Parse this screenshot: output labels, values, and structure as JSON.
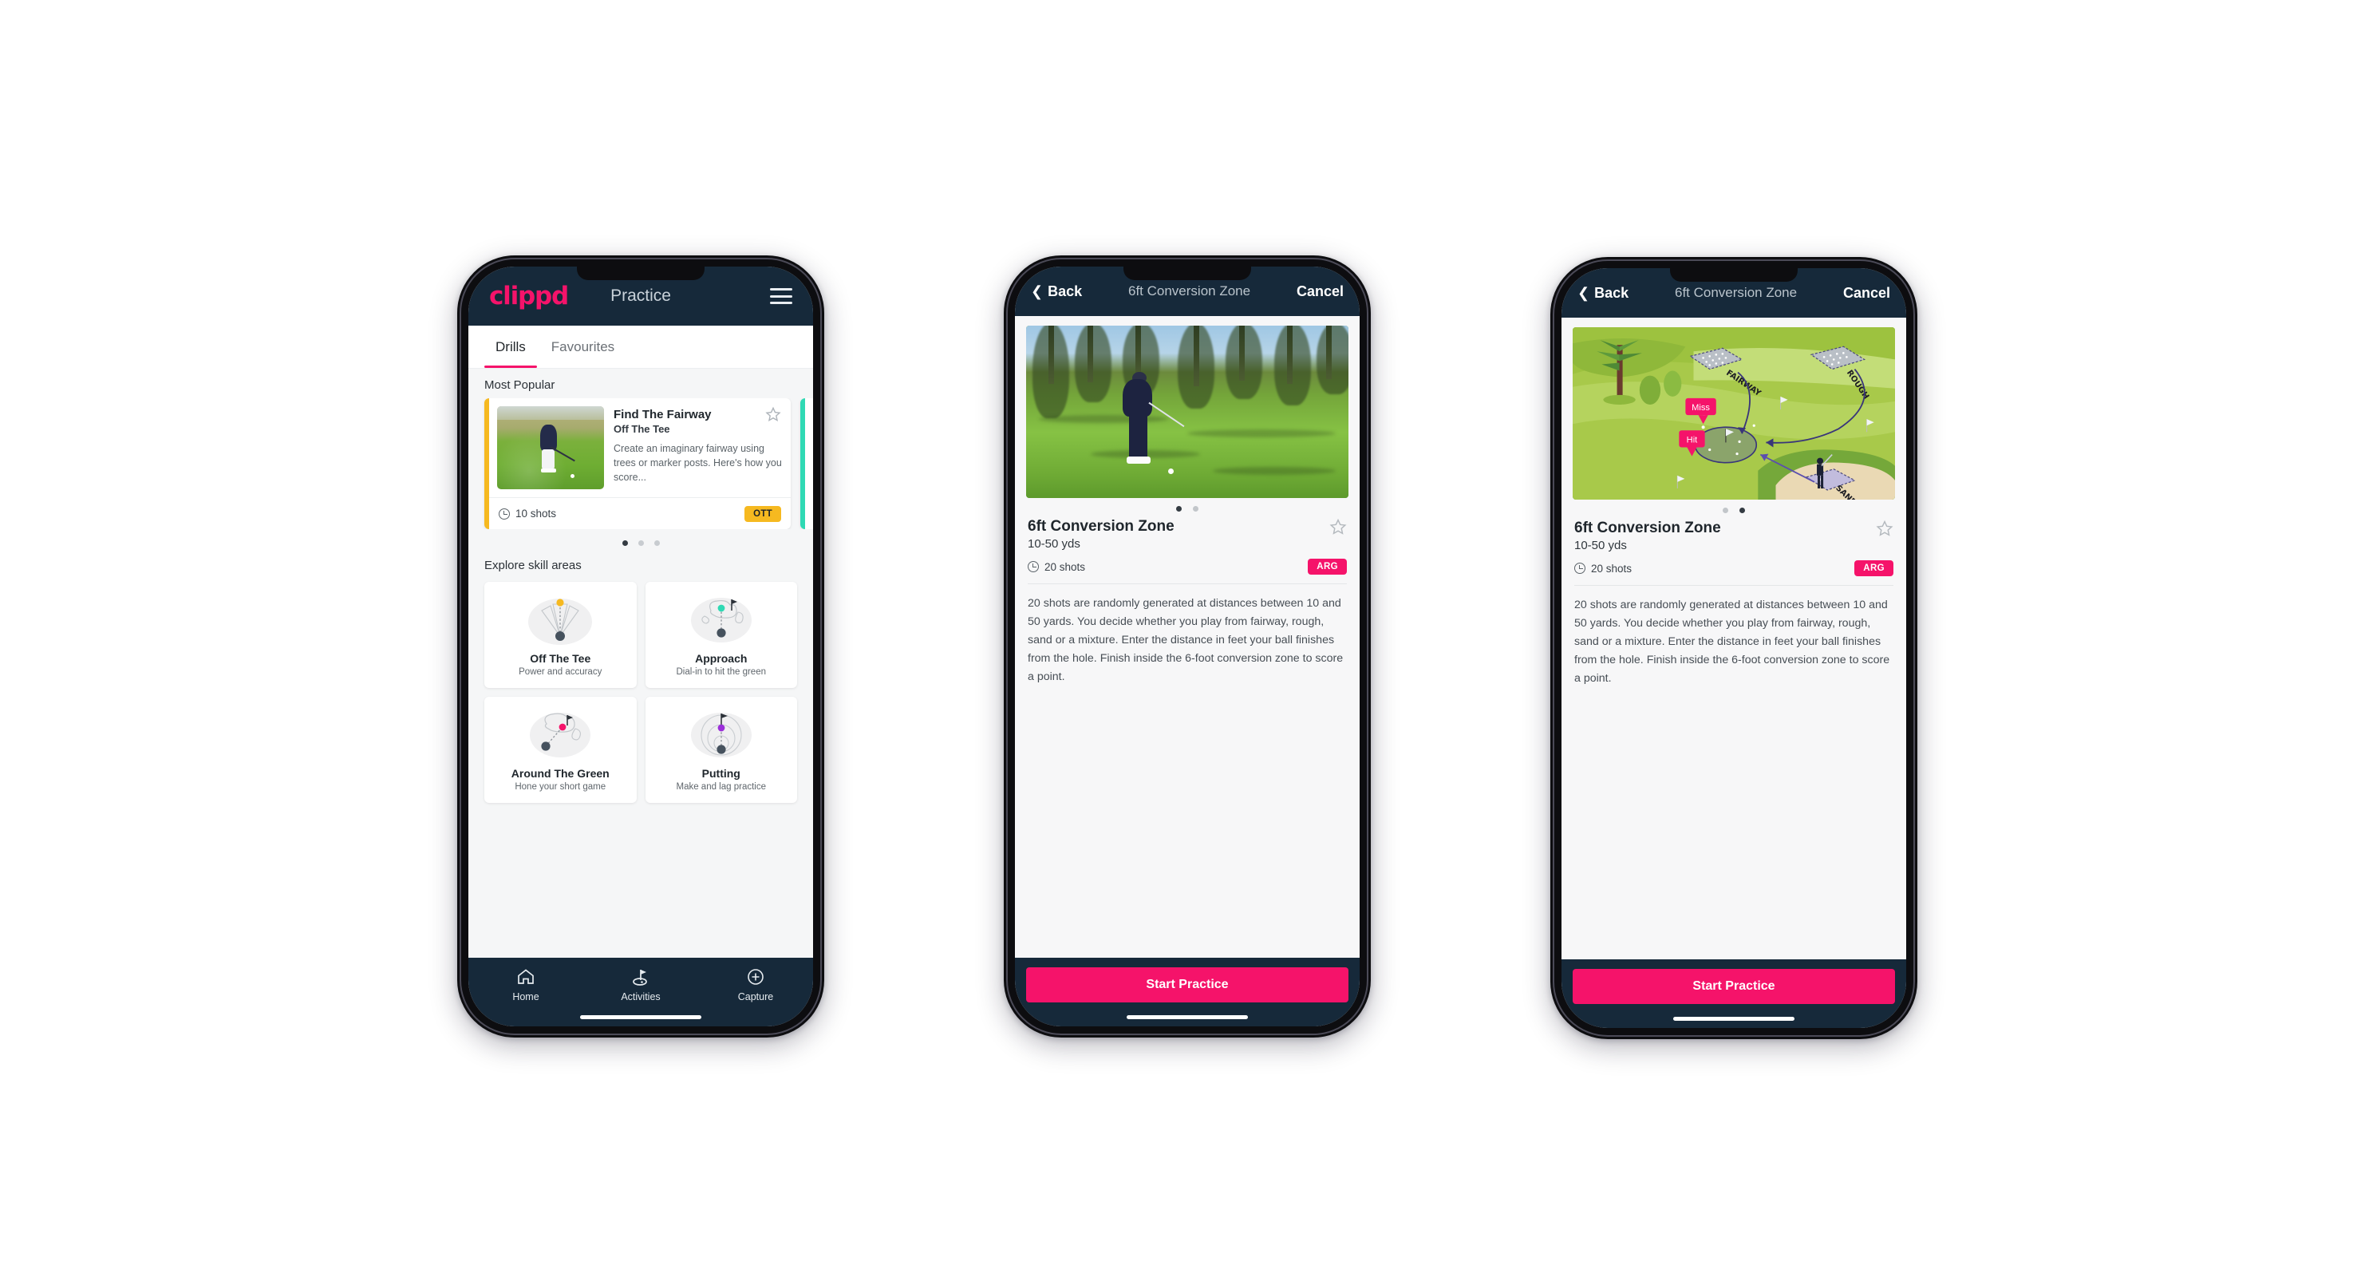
{
  "brand": {
    "accent_pink": "#f5136a",
    "navy": "#16293a",
    "amber": "#f6b920",
    "teal": "#2fd9b4"
  },
  "phone1": {
    "topbar": {
      "logo": "clippd",
      "title": "Practice",
      "menu_icon": "hamburger-icon"
    },
    "tabs": [
      {
        "label": "Drills",
        "active": true
      },
      {
        "label": "Favourites",
        "active": false
      }
    ],
    "most_popular": {
      "section_label": "Most Popular",
      "card": {
        "title": "Find The Fairway",
        "subtitle": "Off The Tee",
        "description": "Create an imaginary fairway using trees or marker posts. Here's how you score...",
        "shots": "10 shots",
        "badge": "OTT",
        "badge_color": "#f6b920",
        "favourite_icon": "star-outline-icon"
      },
      "dots": {
        "count": 3,
        "active_index": 0
      }
    },
    "skills": {
      "section_label": "Explore skill areas",
      "items": [
        {
          "name": "Off The Tee",
          "desc": "Power and accuracy",
          "icon": "tee-fan-icon",
          "accent": "#f6b920"
        },
        {
          "name": "Approach",
          "desc": "Dial-in to hit the green",
          "icon": "green-approach-icon",
          "accent": "#2fd9b4"
        },
        {
          "name": "Around The Green",
          "desc": "Hone your short game",
          "icon": "chip-green-icon",
          "accent": "#f5136a"
        },
        {
          "name": "Putting",
          "desc": "Make and lag practice",
          "icon": "putting-rings-icon",
          "accent": "#9b30d9"
        }
      ]
    },
    "tabbar": [
      {
        "label": "Home",
        "icon": "home-icon",
        "active": false
      },
      {
        "label": "Activities",
        "icon": "flag-green-icon",
        "active": true
      },
      {
        "label": "Capture",
        "icon": "plus-circle-icon",
        "active": false
      }
    ]
  },
  "phone2": {
    "navbar": {
      "back": "Back",
      "title": "6ft Conversion Zone",
      "cancel": "Cancel",
      "back_icon": "chevron-left-icon"
    },
    "hero": {
      "type": "photo",
      "alt": "golfer-chipping-photo"
    },
    "dots": {
      "count": 2,
      "active_index": 0
    },
    "detail": {
      "title": "6ft Conversion Zone",
      "subtitle": "10-50 yds",
      "shots": "20 shots",
      "badge": "ARG",
      "badge_color": "#f5136a",
      "favourite_icon": "star-outline-icon",
      "description": "20 shots are randomly generated at distances between 10 and 50 yards. You decide whether you play from fairway, rough, sand or a mixture. Enter the distance in feet your ball finishes from the hole. Finish inside the 6-foot conversion zone to score a point."
    },
    "cta": "Start Practice"
  },
  "phone3": {
    "navbar": {
      "back": "Back",
      "title": "6ft Conversion Zone",
      "cancel": "Cancel",
      "back_icon": "chevron-left-icon"
    },
    "hero": {
      "type": "illustration",
      "alt": "golf-hole-diagram",
      "labels": [
        "FAIRWAY",
        "ROUGH",
        "SAND"
      ],
      "callouts": [
        "Miss",
        "Hit"
      ]
    },
    "dots": {
      "count": 2,
      "active_index": 1
    },
    "detail": {
      "title": "6ft Conversion Zone",
      "subtitle": "10-50 yds",
      "shots": "20 shots",
      "badge": "ARG",
      "badge_color": "#f5136a",
      "favourite_icon": "star-outline-icon",
      "description": "20 shots are randomly generated at distances between 10 and 50 yards. You decide whether you play from fairway, rough, sand or a mixture. Enter the distance in feet your ball finishes from the hole. Finish inside the 6-foot conversion zone to score a point."
    },
    "cta": "Start Practice"
  }
}
